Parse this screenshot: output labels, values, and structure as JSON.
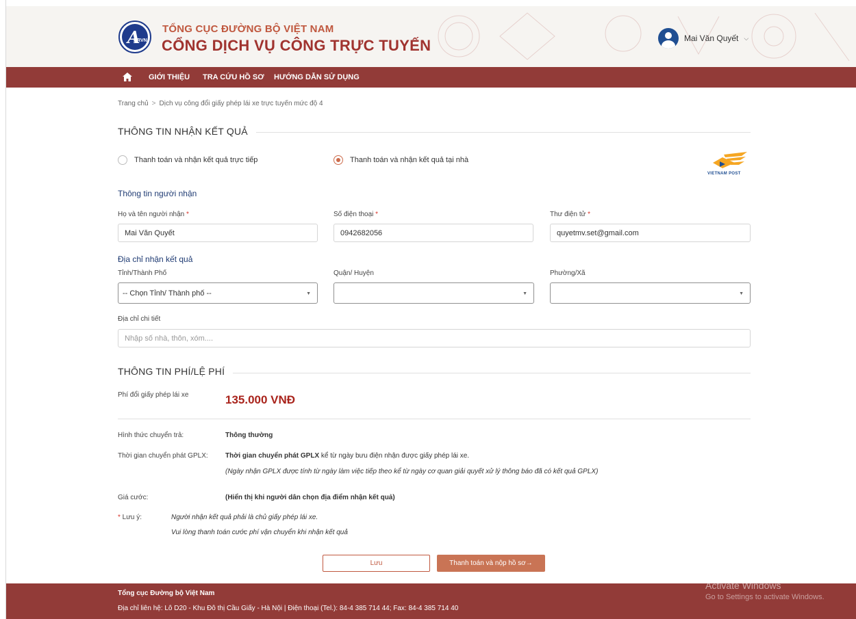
{
  "header": {
    "org_small": "TỔNG CỤC ĐƯỜNG BỘ VIỆT NAM",
    "org_big": "CỔNG DỊCH VỤ CÔNG TRỰC TUYẾN",
    "logo_text": "DRVN",
    "user_name": "Mai Văn Quyết"
  },
  "nav": {
    "items": [
      "GIỚI THIỆU",
      "TRA CỨU HỒ SƠ",
      "HƯỚNG DẪN SỬ DỤNG"
    ]
  },
  "breadcrumb": {
    "home": "Trang chủ",
    "sep": ">",
    "current": "Dịch vụ công đổi giấy phép lái xe trực tuyến mức độ 4"
  },
  "result_section": {
    "title": "THÔNG TIN NHẬN KẾT QUẢ",
    "option_direct": "Thanh toán và nhận kết quả trực tiếp",
    "option_home": "Thanh toán và nhận kết quả tại nhà",
    "selected": "home",
    "vnpost_label": "VIETNAM POST"
  },
  "recipient": {
    "heading": "Thông tin người nhận",
    "name_label": "Họ và tên người nhận",
    "name_value": "Mai Văn Quyết",
    "phone_label": "Số điện thoại",
    "phone_value": "0942682056",
    "email_label": "Thư điện tử",
    "email_value": "quyetmv.set@gmail.com",
    "required_mark": "*"
  },
  "address": {
    "heading": "Địa chỉ nhận kết quả",
    "province_label": "Tỉnh/Thành Phố",
    "province_value": "-- Chọn Tỉnh/ Thành phố --",
    "district_label": "Quận/ Huyện",
    "district_value": "",
    "ward_label": "Phường/Xã",
    "ward_value": "",
    "detail_label": "Địa chỉ chi tiết",
    "detail_placeholder": "Nhập số nhà, thôn, xóm...."
  },
  "fee_section": {
    "title": "THÔNG TIN PHÍ/LỆ PHÍ",
    "fee_label": "Phí đổi giấy phép lái xe",
    "fee_value": "135.000 VNĐ",
    "transfer_label": "Hình thức chuyển trả:",
    "transfer_value": "Thông thường",
    "delivery_label": "Thời gian chuyển phát GPLX:",
    "delivery_bold": "Thời gian chuyển phát GPLX",
    "delivery_rest": " kể từ ngày bưu điện nhận được giấy phép lái xe.",
    "delivery_note": "(Ngày nhận GPLX được tính từ ngày làm việc tiếp theo kể từ ngày cơ quan giải quyết xử lý thông báo đã có kết quả GPLX)",
    "price_label": "Giá cước:",
    "price_value": "(Hiển thị khi người dân chọn địa điểm nhận kết quả)",
    "note_label": "Lưu ý:",
    "note_line1": "Người nhận kết quả phải là chủ giấy phép lái xe.",
    "note_line2": "Vui lòng thanh toán cước phí vận chuyển khi nhận kết quả"
  },
  "actions": {
    "save": "Lưu",
    "pay": "Thanh toán và nộp hồ sơ→"
  },
  "footer": {
    "org": "Tổng cục Đường bộ Việt Nam",
    "address": "Địa chỉ liên hệ: Lô D20 - Khu Đô thị Cầu Giấy - Hà Nội | Điện thoại (Tel.): 84-4 385 714 44; Fax: 84-4 385 714 40"
  },
  "watermark": {
    "line1": "Activate Windows",
    "line2": "Go to Settings to activate Windows."
  },
  "colors": {
    "brand_red": "#923b38",
    "accent_orange": "#c97455",
    "fee_red": "#a9241c",
    "header_bg": "#f6f4f1"
  }
}
